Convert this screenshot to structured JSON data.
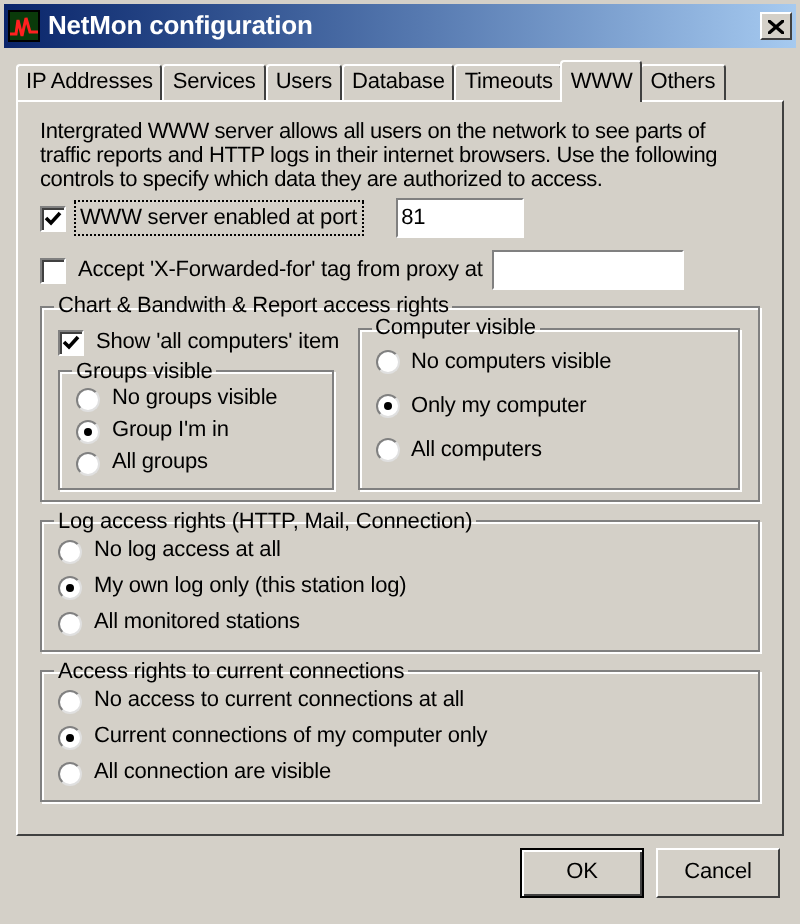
{
  "window": {
    "title": "NetMon configuration"
  },
  "tabs": [
    {
      "label": "IP Addresses",
      "selected": false
    },
    {
      "label": "Services",
      "selected": false
    },
    {
      "label": "Users",
      "selected": false
    },
    {
      "label": "Database",
      "selected": false
    },
    {
      "label": "Timeouts",
      "selected": false
    },
    {
      "label": "WWW",
      "selected": true
    },
    {
      "label": "Others",
      "selected": false
    }
  ],
  "description": "Intergrated WWW server allows all users on the network to see parts of traffic reports and  HTTP logs in their internet browsers.  Use the following controls to specify which data they are authorized to access.",
  "server_enabled": {
    "label": "WWW server enabled at port",
    "checked": true,
    "focused": true,
    "port": "81"
  },
  "forwarded": {
    "label": "Accept 'X-Forwarded-for' tag from proxy at",
    "checked": false
  },
  "chart_group": {
    "title": "Chart & Bandwith & Report access rights",
    "show_all": {
      "label": "Show 'all computers' item",
      "checked": true
    },
    "groups": {
      "title": "Groups visible",
      "options": [
        {
          "label": "No groups visible",
          "selected": false
        },
        {
          "label": "Group I'm in",
          "selected": true
        },
        {
          "label": "All groups",
          "selected": false
        }
      ]
    },
    "computers": {
      "title": "Computer visible",
      "options": [
        {
          "label": "No computers visible",
          "selected": false
        },
        {
          "label": "Only my computer",
          "selected": true
        },
        {
          "label": "All computers",
          "selected": false
        }
      ]
    }
  },
  "log_group": {
    "title": "Log access rights (HTTP, Mail, Connection)",
    "options": [
      {
        "label": "No log access at all",
        "selected": false
      },
      {
        "label": "My own log only (this station log)",
        "selected": true
      },
      {
        "label": "All monitored stations",
        "selected": false
      }
    ]
  },
  "connections_group": {
    "title": "Access rights to current connections",
    "options": [
      {
        "label": "No access to current connections at all",
        "selected": false
      },
      {
        "label": "Current connections of my computer only",
        "selected": true
      },
      {
        "label": "All connection are visible",
        "selected": false
      }
    ]
  },
  "buttons": [
    {
      "label": "OK",
      "kind": "default"
    },
    {
      "label": "Cancel",
      "kind": "normal"
    }
  ]
}
